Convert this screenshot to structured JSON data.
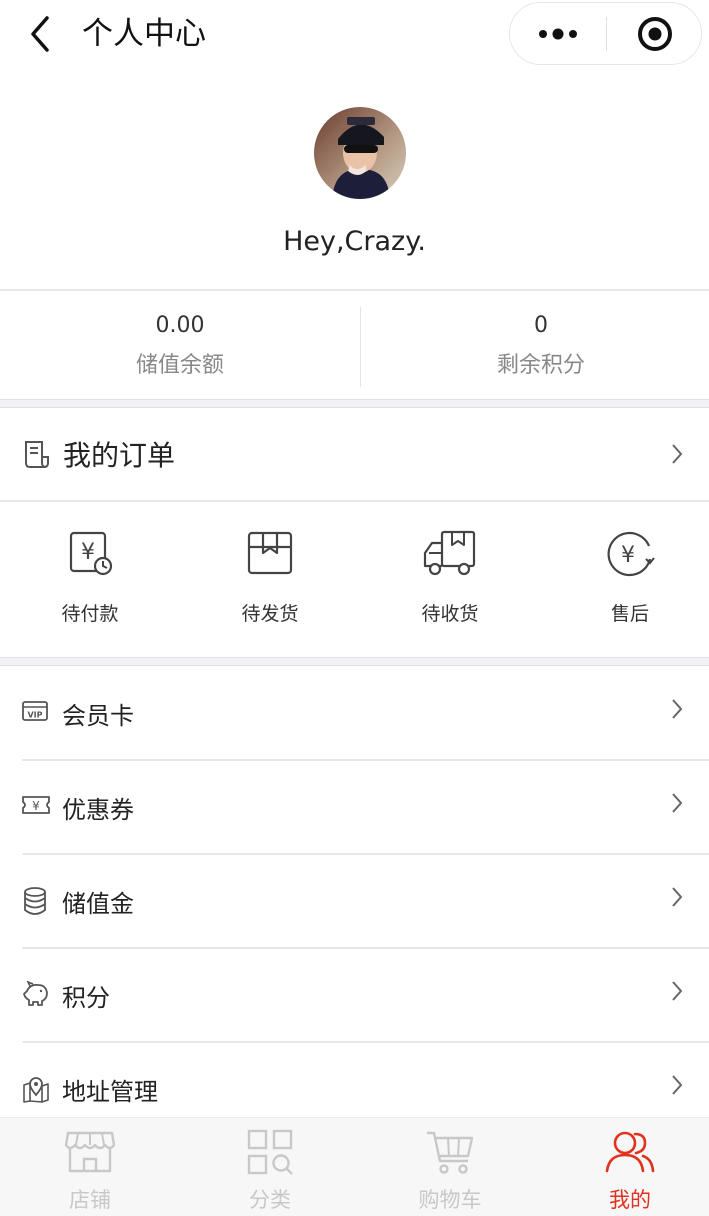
{
  "header": {
    "title": "个人中心"
  },
  "profile": {
    "username": "Hey,Crazy."
  },
  "stats": [
    {
      "value": "0.00",
      "label": "储值余额"
    },
    {
      "value": "0",
      "label": "剩余积分"
    }
  ],
  "orders": {
    "title": "我的订单",
    "items": [
      {
        "label": "待付款",
        "icon": "pending-payment-icon"
      },
      {
        "label": "待发货",
        "icon": "pending-shipment-icon"
      },
      {
        "label": "待收货",
        "icon": "pending-receipt-icon"
      },
      {
        "label": "售后",
        "icon": "after-sales-icon"
      }
    ]
  },
  "menu": [
    {
      "label": "会员卡",
      "icon": "vip-card-icon"
    },
    {
      "label": "优惠券",
      "icon": "coupon-icon"
    },
    {
      "label": "储值金",
      "icon": "coin-stack-icon"
    },
    {
      "label": "积分",
      "icon": "piggy-bank-icon"
    },
    {
      "label": "地址管理",
      "icon": "map-pin-icon"
    }
  ],
  "tabbar": {
    "active": "我的",
    "tabs": [
      {
        "label": "店铺",
        "icon": "store-icon"
      },
      {
        "label": "分类",
        "icon": "category-icon"
      },
      {
        "label": "购物车",
        "icon": "cart-icon"
      },
      {
        "label": "我的",
        "icon": "user-icon"
      }
    ]
  },
  "colors": {
    "accent": "#e0321e",
    "inactive": "#c8c8c8",
    "divider": "#e8e8e8",
    "section_gap": "#f2f1f6"
  }
}
